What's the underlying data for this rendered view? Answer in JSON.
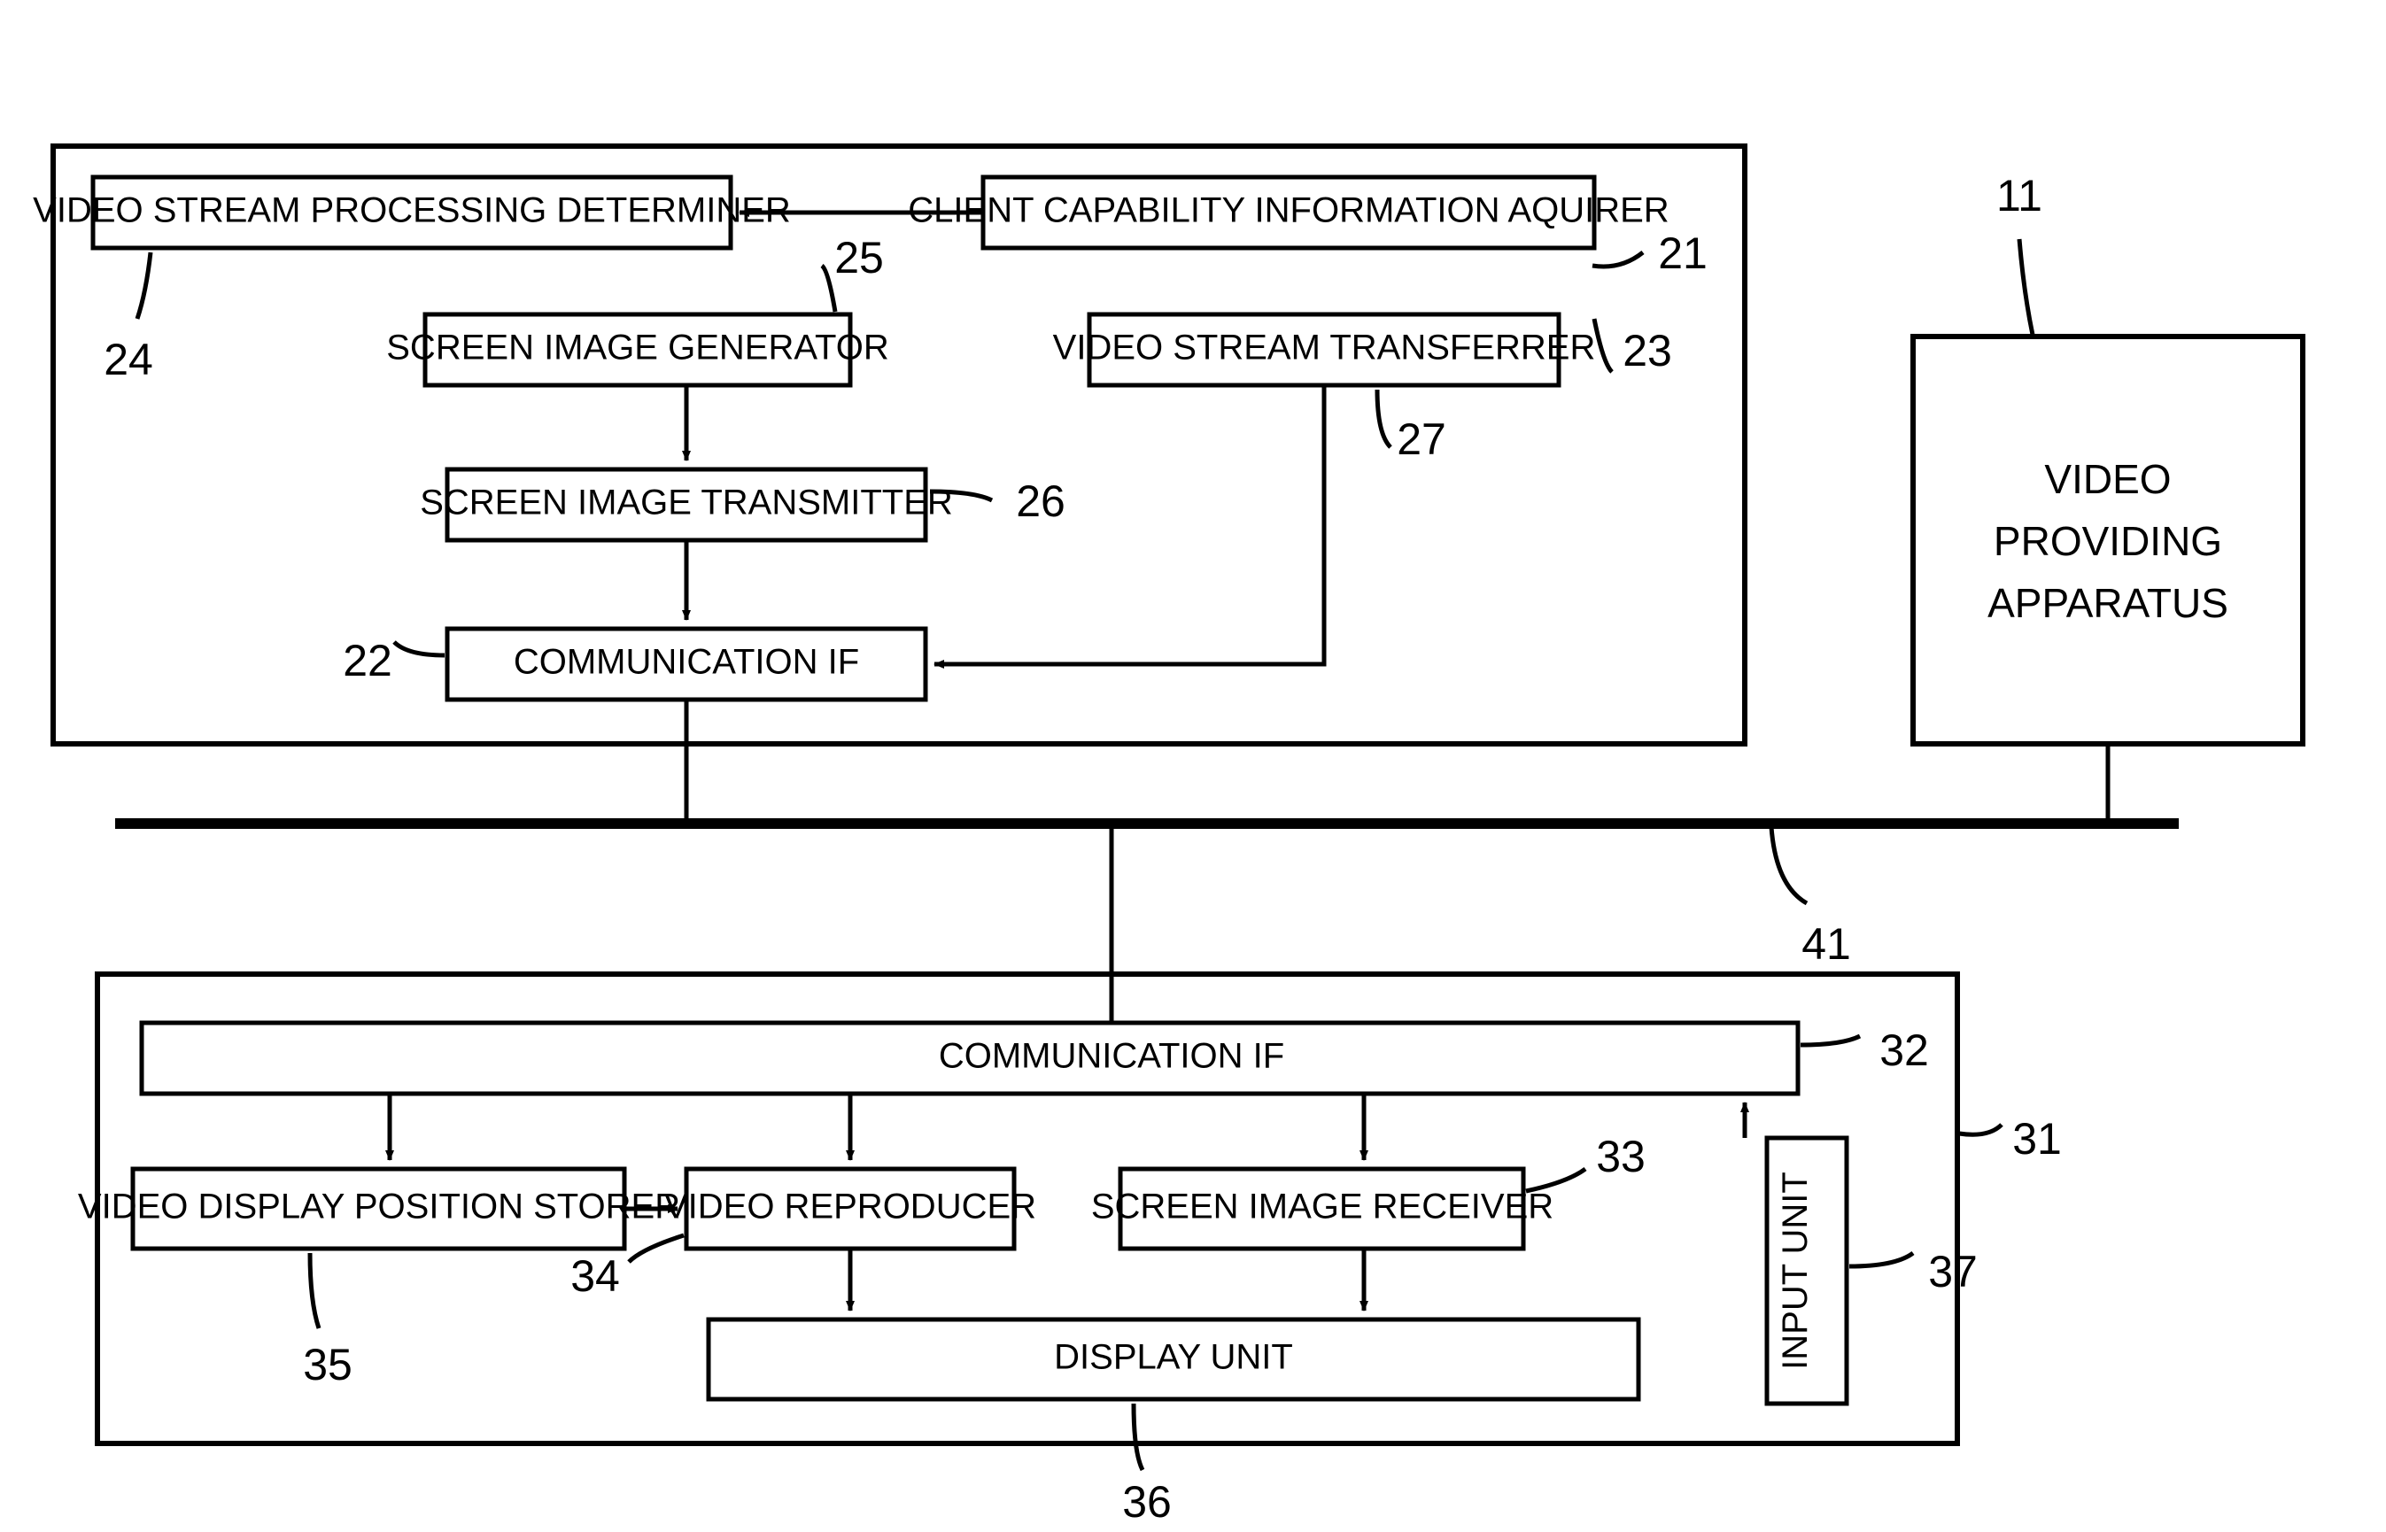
{
  "top_block_ref": "21",
  "bottom_block_ref": "31",
  "right_block": {
    "line1": "VIDEO",
    "line2": "PROVIDING",
    "line3": "APPARATUS",
    "ref": "11"
  },
  "bus_ref": "41",
  "top": {
    "box24": {
      "label": "VIDEO STREAM PROCESSING DETERMINER",
      "ref": "24"
    },
    "box23": {
      "label": "CLIENT CAPABILITY INFORMATION AQUIRER",
      "ref": "23"
    },
    "box25": {
      "label": "SCREEN IMAGE GENERATOR",
      "ref": "25"
    },
    "box27": {
      "label": "VIDEO STREAM TRANSFERRER",
      "ref": "27"
    },
    "box26": {
      "label": "SCREEN IMAGE TRANSMITTER",
      "ref": "26"
    },
    "box22": {
      "label": "COMMUNICATION IF",
      "ref": "22"
    }
  },
  "bottom": {
    "box32": {
      "label": "COMMUNICATION IF",
      "ref": "32"
    },
    "box35": {
      "label": "VIDEO DISPLAY POSITION STORER",
      "ref": "35"
    },
    "box34": {
      "label": "VIDEO REPRODUCER",
      "ref": "34"
    },
    "box33": {
      "label": "SCREEN IMAGE RECEIVER",
      "ref": "33"
    },
    "box36": {
      "label": "DISPLAY UNIT",
      "ref": "36"
    },
    "box37": {
      "label": "INPUT UNIT",
      "ref": "37"
    }
  }
}
